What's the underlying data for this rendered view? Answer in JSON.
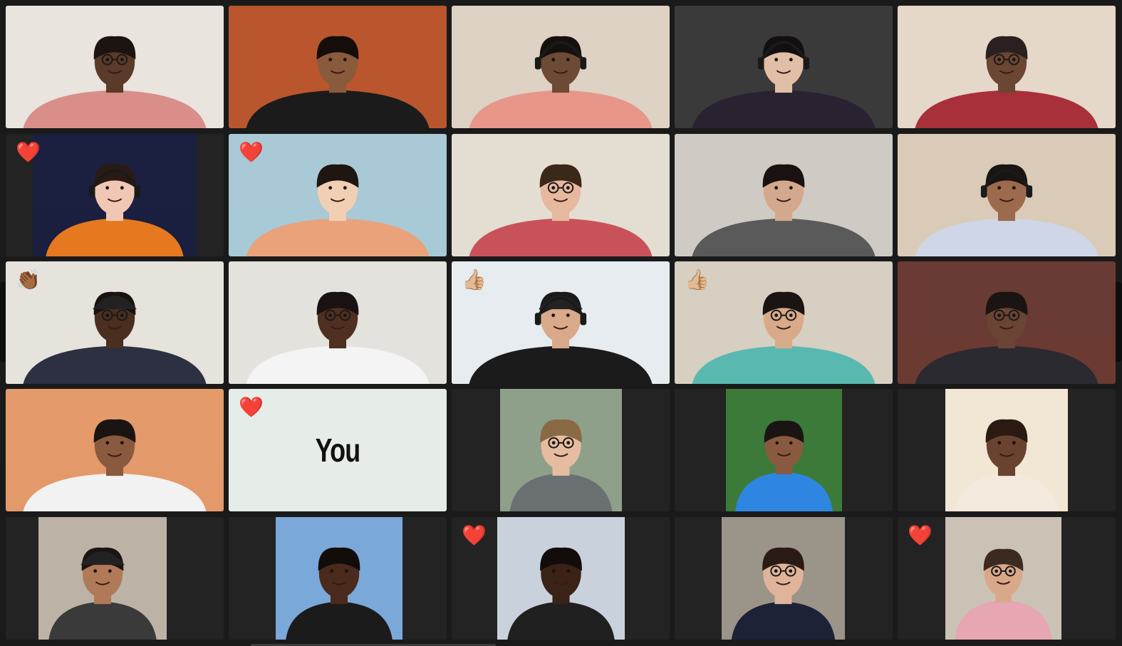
{
  "meeting": {
    "self_label": "You"
  },
  "participants": [
    {
      "id": "p1",
      "reaction": "",
      "portrait": "full",
      "bg": "#e9e4de",
      "skin": "#5a3a28",
      "shirt": "#d98e8a",
      "hair": "#1c1410",
      "glasses": true,
      "headphones": false,
      "cap": false
    },
    {
      "id": "p2",
      "reaction": "",
      "portrait": "full",
      "bg": "#b9562e",
      "skin": "#8a5a3c",
      "shirt": "#1b1b1b",
      "hair": "#140d0a",
      "glasses": false,
      "headphones": false,
      "cap": false
    },
    {
      "id": "p3",
      "reaction": "",
      "portrait": "full",
      "bg": "#ddd2c4",
      "skin": "#6d4a34",
      "shirt": "#e8958a",
      "hair": "#16100c",
      "glasses": false,
      "headphones": true,
      "cap": false
    },
    {
      "id": "p4",
      "reaction": "",
      "portrait": "full",
      "bg": "#3a3a3a",
      "skin": "#e1bfa6",
      "shirt": "#2a2230",
      "hair": "#120f10",
      "glasses": false,
      "headphones": true,
      "cap": false
    },
    {
      "id": "p5",
      "reaction": "",
      "portrait": "full",
      "bg": "#e5d8c8",
      "skin": "#6b4633",
      "shirt": "#a8303a",
      "hair": "#2a2020",
      "glasses": true,
      "headphones": false,
      "cap": false
    },
    {
      "id": "p6",
      "reaction": "heart",
      "portrait": "narrow",
      "bg": "#1b2040",
      "skin": "#f0c6b4",
      "shirt": "#e6781f",
      "hair": "#2a1a14",
      "glasses": false,
      "headphones": true,
      "cap": false
    },
    {
      "id": "p7",
      "reaction": "heart",
      "portrait": "full",
      "bg": "#a9c9d6",
      "skin": "#f1cfb4",
      "shirt": "#eaa27a",
      "hair": "#1f1612",
      "glasses": false,
      "headphones": false,
      "cap": false
    },
    {
      "id": "p8",
      "reaction": "",
      "portrait": "full",
      "bg": "#e4ddd2",
      "skin": "#e6b89e",
      "shirt": "#c9525a",
      "hair": "#3a2818",
      "glasses": true,
      "headphones": false,
      "cap": false
    },
    {
      "id": "p9",
      "reaction": "",
      "portrait": "full",
      "bg": "#cfcac4",
      "skin": "#d4a88c",
      "shirt": "#5a5a5a",
      "hair": "#1a1210",
      "glasses": false,
      "headphones": false,
      "cap": false,
      "active": true
    },
    {
      "id": "p10",
      "reaction": "",
      "portrait": "full",
      "bg": "#dacbb8",
      "skin": "#9c6a4c",
      "shirt": "#cfd6e8",
      "hair": "#1a1412",
      "glasses": false,
      "headphones": true,
      "cap": false
    },
    {
      "id": "p11",
      "reaction": "clap",
      "portrait": "full",
      "bg": "#e6e2dc",
      "skin": "#4a2e1f",
      "shirt": "#2c3040",
      "hair": "#1a1210",
      "glasses": true,
      "headphones": false,
      "cap": true
    },
    {
      "id": "p12",
      "reaction": "",
      "portrait": "full",
      "bg": "#e4e2dd",
      "skin": "#4f2f20",
      "shirt": "#f4f4f4",
      "hair": "#1a1210",
      "glasses": true,
      "headphones": false,
      "cap": false
    },
    {
      "id": "p13",
      "reaction": "thumbs",
      "portrait": "full",
      "bg": "#e6ecef",
      "skin": "#d9a98a",
      "shirt": "#1b1b1b",
      "hair": "#1a1a1a",
      "glasses": false,
      "headphones": true,
      "cap": true
    },
    {
      "id": "p14",
      "reaction": "thumbs",
      "portrait": "full",
      "bg": "#d6cfc2",
      "skin": "#d8aa8a",
      "shirt": "#59b8b0",
      "hair": "#1a1412",
      "glasses": true,
      "headphones": false,
      "cap": false
    },
    {
      "id": "p15",
      "reaction": "",
      "portrait": "full",
      "bg": "#6a3a34",
      "skin": "#6a4434",
      "shirt": "#2a2a30",
      "hair": "#1a1412",
      "glasses": true,
      "headphones": false,
      "cap": false
    },
    {
      "id": "p16",
      "reaction": "",
      "portrait": "full",
      "bg": "#e49a6a",
      "skin": "#8a5a3e",
      "shirt": "#f2f2f2",
      "hair": "#1a1412",
      "glasses": false,
      "headphones": false,
      "cap": false
    },
    {
      "id": "p17",
      "reaction": "heart",
      "portrait": "you"
    },
    {
      "id": "p18",
      "reaction": "",
      "portrait": "narrow",
      "bg": "#8ea08a",
      "skin": "#e6bca0",
      "shirt": "#6a6f72",
      "hair": "#8a6a44",
      "glasses": true,
      "headphones": false,
      "cap": false
    },
    {
      "id": "p19",
      "reaction": "",
      "portrait": "narrow",
      "bg": "#3c7a3a",
      "skin": "#8a5a40",
      "shirt": "#2f86e0",
      "hair": "#1a1412",
      "glasses": false,
      "headphones": false,
      "cap": false
    },
    {
      "id": "p20",
      "reaction": "",
      "portrait": "narrow",
      "bg": "#f1e7d4",
      "skin": "#6a4230",
      "shirt": "#f3eadd",
      "hair": "#2a1a12",
      "glasses": false,
      "headphones": false,
      "cap": false
    },
    {
      "id": "p21",
      "reaction": "",
      "portrait": "narrow",
      "bg": "#bcb3a6",
      "skin": "#b07a58",
      "shirt": "#3a3a3a",
      "hair": "#1a1412",
      "glasses": false,
      "headphones": false,
      "cap": true
    },
    {
      "id": "p22",
      "reaction": "",
      "portrait": "narrow",
      "bg": "#7aa8d8",
      "skin": "#4a2a1c",
      "shirt": "#1b1b1b",
      "hair": "#120c0a",
      "glasses": false,
      "headphones": false,
      "cap": false
    },
    {
      "id": "p23",
      "reaction": "heart",
      "portrait": "narrow",
      "bg": "#c9d2dc",
      "skin": "#3a2216",
      "shirt": "#202020",
      "hair": "#120c0a",
      "glasses": false,
      "headphones": false,
      "cap": false
    },
    {
      "id": "p24",
      "reaction": "",
      "portrait": "narrow",
      "bg": "#9b9488",
      "skin": "#e0b49a",
      "shirt": "#1d2236",
      "hair": "#2a1a14",
      "glasses": true,
      "headphones": false,
      "cap": false
    },
    {
      "id": "p25",
      "reaction": "heart",
      "portrait": "narrow",
      "bg": "#cbc2b6",
      "skin": "#d9a88a",
      "shirt": "#e6a6b2",
      "hair": "#3a2a20",
      "glasses": true,
      "headphones": false,
      "cap": false
    }
  ],
  "reaction_glyphs": {
    "heart": "❤️",
    "clap": "👏🏾",
    "thumbs": "👍🏼"
  },
  "colors": {
    "background": "#1a1a1a",
    "tile": "#232323",
    "active_speaker_border": "#31c74b",
    "you_tile": "#e6ede8"
  }
}
